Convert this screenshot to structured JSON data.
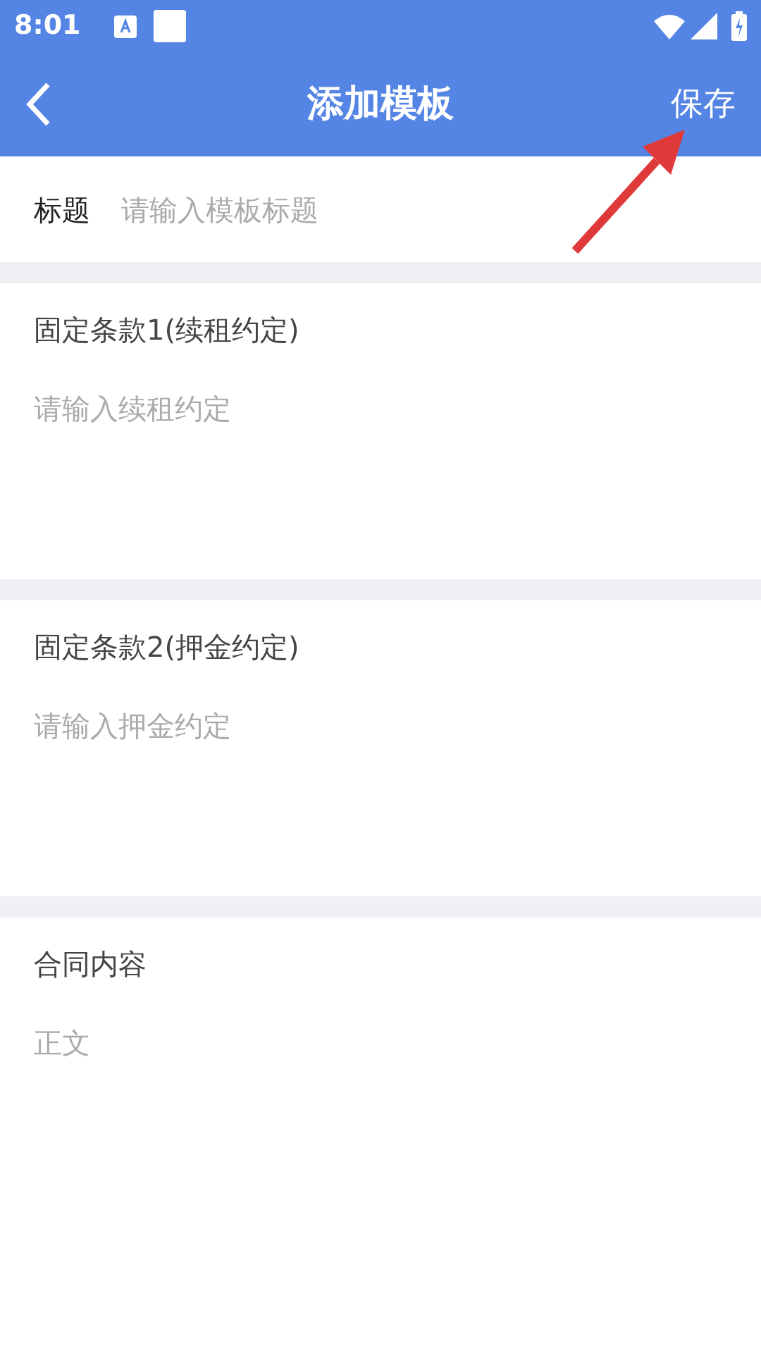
{
  "status_bar": {
    "time": "8:01"
  },
  "header": {
    "title": "添加模板",
    "action": "保存"
  },
  "title_field": {
    "label": "标题",
    "placeholder": "请输入模板标题"
  },
  "sections": [
    {
      "label": "固定条款1(续租约定)",
      "placeholder": "请输入续租约定"
    },
    {
      "label": "固定条款2(押金约定)",
      "placeholder": "请输入押金约定"
    },
    {
      "label": "合同内容",
      "placeholder": "正文"
    }
  ]
}
